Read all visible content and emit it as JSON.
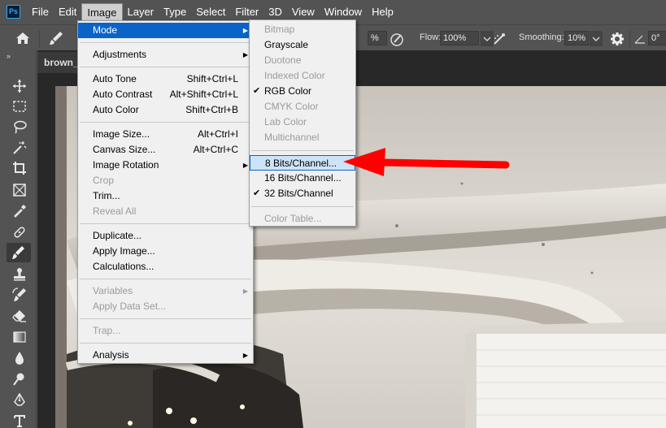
{
  "app": {
    "logo": "Ps"
  },
  "menubar": {
    "items": [
      "File",
      "Edit",
      "Image",
      "Layer",
      "Type",
      "Select",
      "Filter",
      "3D",
      "View",
      "Window",
      "Help"
    ],
    "active_index": 2
  },
  "options_bar": {
    "opacity_value": "%",
    "flow_label": "Flow:",
    "flow_value": "100%",
    "smoothing_label": "Smoothing:",
    "smoothing_value": "10%",
    "angle_value": "0°"
  },
  "document": {
    "tab_title": "brown_"
  },
  "image_menu": {
    "items": [
      {
        "label": "Mode",
        "submenu": true,
        "highlight": true
      },
      {
        "separator": true
      },
      {
        "label": "Adjustments",
        "submenu": true
      },
      {
        "separator": true
      },
      {
        "label": "Auto Tone",
        "shortcut": "Shift+Ctrl+L"
      },
      {
        "label": "Auto Contrast",
        "shortcut": "Alt+Shift+Ctrl+L"
      },
      {
        "label": "Auto Color",
        "shortcut": "Shift+Ctrl+B"
      },
      {
        "separator": true
      },
      {
        "label": "Image Size...",
        "shortcut": "Alt+Ctrl+I"
      },
      {
        "label": "Canvas Size...",
        "shortcut": "Alt+Ctrl+C"
      },
      {
        "label": "Image Rotation",
        "submenu": true
      },
      {
        "label": "Crop",
        "disabled": true
      },
      {
        "label": "Trim..."
      },
      {
        "label": "Reveal All",
        "disabled": true
      },
      {
        "separator": true
      },
      {
        "label": "Duplicate..."
      },
      {
        "label": "Apply Image..."
      },
      {
        "label": "Calculations..."
      },
      {
        "separator": true
      },
      {
        "label": "Variables",
        "submenu": true,
        "disabled": true
      },
      {
        "label": "Apply Data Set...",
        "disabled": true
      },
      {
        "separator": true
      },
      {
        "label": "Trap...",
        "disabled": true
      },
      {
        "separator": true
      },
      {
        "label": "Analysis",
        "submenu": true
      }
    ]
  },
  "mode_submenu": {
    "items": [
      {
        "label": "Bitmap",
        "disabled": true
      },
      {
        "label": "Grayscale"
      },
      {
        "label": "Duotone",
        "disabled": true
      },
      {
        "label": "Indexed Color",
        "disabled": true
      },
      {
        "label": "RGB Color",
        "checked": true
      },
      {
        "label": "CMYK Color",
        "disabled": true
      },
      {
        "label": "Lab Color",
        "disabled": true
      },
      {
        "label": "Multichannel",
        "disabled": true
      },
      {
        "separator": true
      },
      {
        "label": "8 Bits/Channel...",
        "selected": true
      },
      {
        "label": "16 Bits/Channel..."
      },
      {
        "label": "32 Bits/Channel",
        "checked": true
      },
      {
        "separator": true
      },
      {
        "label": "Color Table...",
        "disabled": true
      }
    ]
  },
  "colors": {
    "menu_highlight": "#0a64c8",
    "annotation_arrow": "#ff0000",
    "ps_blue": "#31a8ff"
  }
}
